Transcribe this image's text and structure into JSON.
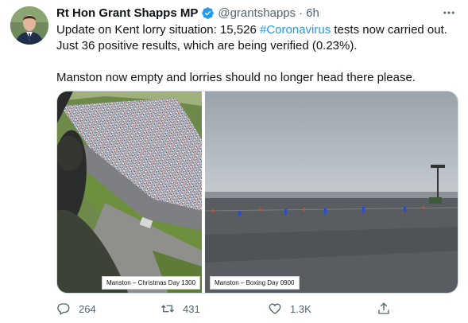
{
  "tweet": {
    "author_name": "Rt Hon Grant Shapps MP",
    "handle": "@grantshapps",
    "separator": "·",
    "time": "6h",
    "text_line1_prefix": "Update on Kent lorry situation: 15,526 ",
    "hashtag": "#Coronavirus",
    "text_line1_suffix": " tests now carried out.",
    "text_line2": "Just 36 positive results, which are being verified (0.23%).",
    "text_line3": "Manston now empty and lorries should no longer head there please."
  },
  "media": {
    "left_caption": "Manston – Christmas Day 1300",
    "right_caption": "Manston – Boxing Day 0900"
  },
  "actions": {
    "reply_count": "264",
    "retweet_count": "431",
    "like_count": "1.3K"
  },
  "icons": [
    "verified-badge-icon",
    "more-icon",
    "reply-icon",
    "retweet-icon",
    "like-icon",
    "share-icon"
  ],
  "colors": {
    "link": "#1d9bf0",
    "verified": "#1d9bf0",
    "secondary_text": "#536471"
  }
}
